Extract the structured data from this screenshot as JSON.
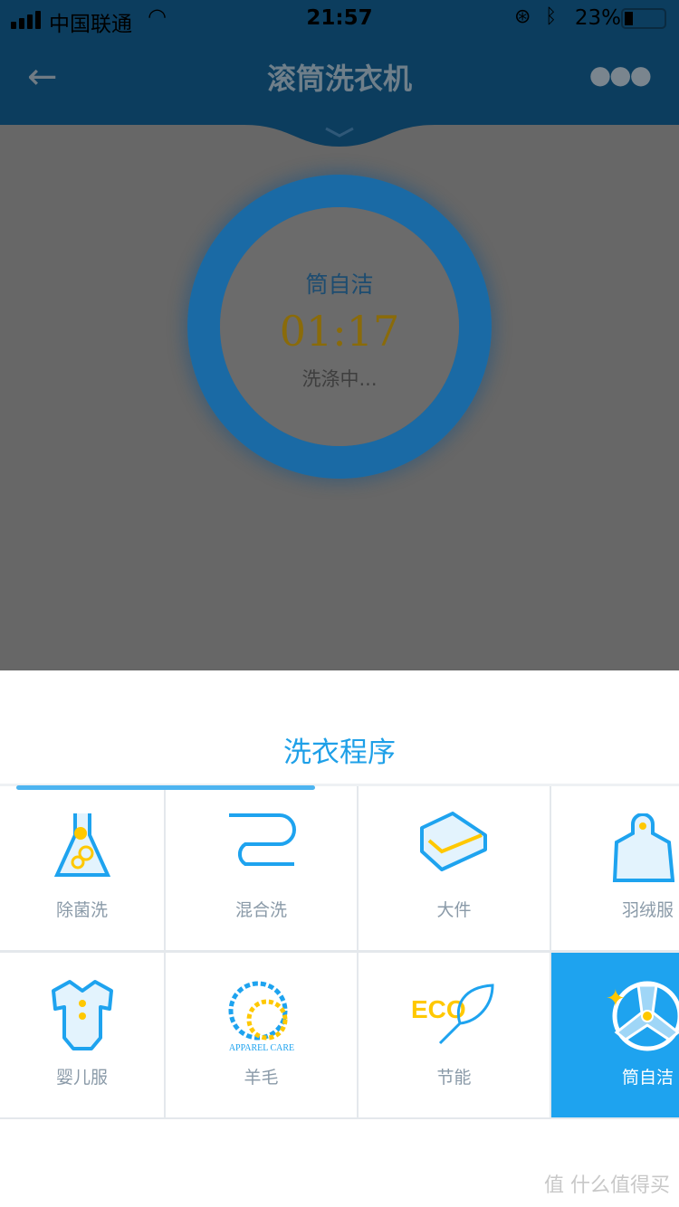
{
  "status_bar": {
    "carrier": "中国联通",
    "time": "21:57",
    "battery": "23%",
    "battery_level": 0.23
  },
  "nav": {
    "title": "滚筒洗衣机",
    "back_icon": "arrow-left-icon",
    "more_icon": "more-dots-icon"
  },
  "status_panel": {
    "program": "筒自洁",
    "remaining": "01:17",
    "state": "洗涤中..."
  },
  "sheet": {
    "title": "洗衣程序",
    "programs": [
      {
        "label": "除菌洗",
        "icon": "flask-icon"
      },
      {
        "label": "混合洗",
        "icon": "mixed-fabric-icon"
      },
      {
        "label": "大件",
        "icon": "bulky-item-icon"
      },
      {
        "label": "羽绒服",
        "icon": "down-jacket-icon"
      },
      {
        "label": "婴儿服",
        "icon": "baby-onesie-icon"
      },
      {
        "label": "羊毛",
        "icon": "woolmark-icon",
        "logo_text": "APPAREL CARE"
      },
      {
        "label": "节能",
        "icon": "eco-leaf-icon",
        "logo_text": "ECO"
      },
      {
        "label": "筒自洁",
        "icon": "drum-clean-icon",
        "selected": true
      }
    ]
  },
  "watermark": "值 什么值得买",
  "colors": {
    "accent": "#1ea3ef",
    "yellow": "#ffc800"
  }
}
